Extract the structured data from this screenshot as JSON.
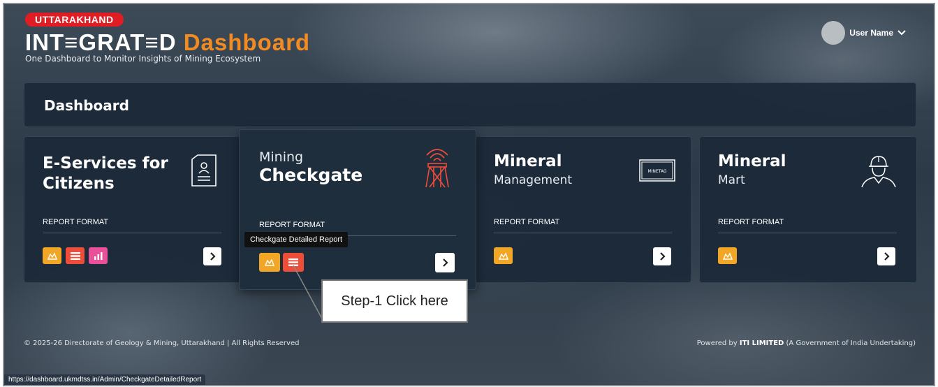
{
  "header": {
    "state_badge": "UTTARAKHAND",
    "title_part1": "INT≡GRAT≡D",
    "title_part2": "Dashboard",
    "subtitle": "One Dashboard to Monitor Insights of Mining Ecosystem",
    "user_name": "User Name"
  },
  "dashboard_title": "Dashboard",
  "cards": [
    {
      "title_line1": "E-Services for",
      "title_line2": "Citizens",
      "report_label": "REPORT FORMAT",
      "icon": "document-user-icon"
    },
    {
      "title_line1": "Mining",
      "title_line2": "Checkgate",
      "report_label": "REPORT FORMAT",
      "icon": "checkgate-tower-icon"
    },
    {
      "title_line1": "Mineral",
      "title_line2": "Management",
      "report_label": "REPORT FORMAT",
      "icon": "minetag-icon",
      "icon_text": "MINETAG"
    },
    {
      "title_line1": "Mineral",
      "title_line2": "Mart",
      "report_label": "REPORT FORMAT",
      "icon": "worker-helmet-icon"
    }
  ],
  "tooltip": "Checkgate Detailed Report",
  "callout": "Step-1 Click here",
  "footer": {
    "left": "© 2025-26 Directorate of Geology & Mining, Uttarakhand | All Rights Reserved",
    "right_prefix": "Powered by ",
    "right_bold": "ITI LIMITED",
    "right_suffix": " (A Government of India Undertaking)"
  },
  "status_url": "https://dashboard.ukmdtss.in/Admin/CheckgateDetailedReport",
  "colors": {
    "badge_red": "#e11d24",
    "title_orange": "#f28b22",
    "btn_orange": "#f2a626",
    "btn_red": "#ee4d3a",
    "btn_pink": "#e8509a",
    "card_bg": "#1b2938"
  }
}
